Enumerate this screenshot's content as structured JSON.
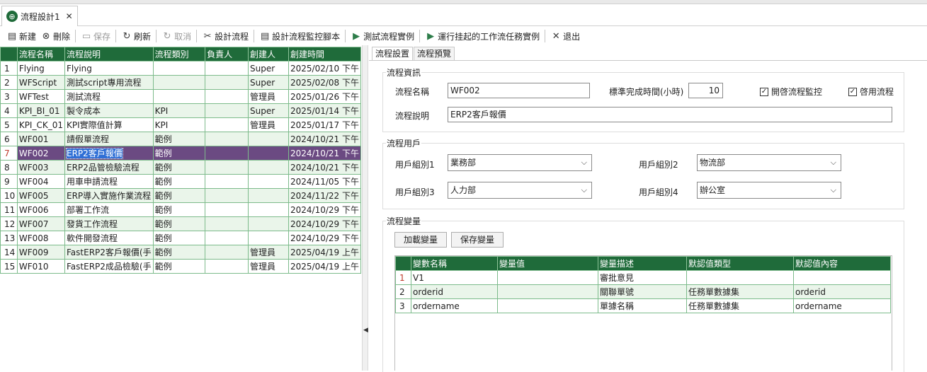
{
  "tab": {
    "title": "流程設計1",
    "close": "✕"
  },
  "toolbar": {
    "new": "新建",
    "delete": "刪除",
    "save": "保存",
    "refresh": "刷新",
    "cancel": "取消",
    "design": "設計流程",
    "monitor_script": "設計流程監控腳本",
    "test": "測試流程實例",
    "run_pending": "運行挂起的工作流任務實例",
    "exit": "退出"
  },
  "flow_grid": {
    "columns": [
      "流程名稱",
      "流程說明",
      "流程類別",
      "負責人",
      "創建人",
      "創建時間"
    ],
    "rows": [
      {
        "n": "1",
        "name": "Flying",
        "desc": "Flying",
        "cat": "",
        "owner": "",
        "creator": "Super",
        "time": "2025/02/10 下午"
      },
      {
        "n": "2",
        "name": "WFScript",
        "desc": "測試script專用流程",
        "cat": "",
        "owner": "",
        "creator": "Super",
        "time": "2025/02/08 下午"
      },
      {
        "n": "3",
        "name": "WFTest",
        "desc": "測試流程",
        "cat": "",
        "owner": "",
        "creator": "管理員",
        "time": "2025/01/26 下午"
      },
      {
        "n": "4",
        "name": "KPI_BI_01",
        "desc": "製令成本",
        "cat": "KPI",
        "owner": "",
        "creator": "Super",
        "time": "2025/01/14 下午"
      },
      {
        "n": "5",
        "name": "KPI_CK_01",
        "desc": "KPI實際值計算",
        "cat": "KPI",
        "owner": "",
        "creator": "管理員",
        "time": "2025/01/17 下午"
      },
      {
        "n": "6",
        "name": "WF001",
        "desc": "請假單流程",
        "cat": "範例",
        "owner": "",
        "creator": "",
        "time": "2024/10/21 下午"
      },
      {
        "n": "7",
        "name": "WF002",
        "desc": "ERP2客戶報價",
        "cat": "範例",
        "owner": "",
        "creator": "",
        "time": "2024/10/21 下午"
      },
      {
        "n": "8",
        "name": "WF003",
        "desc": "ERP2品管檢驗流程",
        "cat": "範例",
        "owner": "",
        "creator": "",
        "time": "2024/10/21 下午"
      },
      {
        "n": "9",
        "name": "WF004",
        "desc": "用車申請流程",
        "cat": "範例",
        "owner": "",
        "creator": "",
        "time": "2024/11/05 下午"
      },
      {
        "n": "10",
        "name": "WF005",
        "desc": "ERP導入實施作業流程",
        "cat": "範例",
        "owner": "",
        "creator": "",
        "time": "2024/11/22 下午"
      },
      {
        "n": "11",
        "name": "WF006",
        "desc": "部署工作流",
        "cat": "範例",
        "owner": "",
        "creator": "",
        "time": "2024/10/29 下午"
      },
      {
        "n": "12",
        "name": "WF007",
        "desc": "發貨工作流程",
        "cat": "範例",
        "owner": "",
        "creator": "",
        "time": "2024/10/29 下午"
      },
      {
        "n": "13",
        "name": "WF008",
        "desc": "軟件開發流程",
        "cat": "範例",
        "owner": "",
        "creator": "",
        "time": "2024/10/29 下午"
      },
      {
        "n": "14",
        "name": "WF009",
        "desc": "FastERP2客戶報價(手",
        "cat": "範例",
        "owner": "",
        "creator": "管理員",
        "time": "2025/04/19 上午"
      },
      {
        "n": "15",
        "name": "WF010",
        "desc": "FastERP2成品檢驗(手",
        "cat": "範例",
        "owner": "",
        "creator": "管理員",
        "time": "2025/04/19 上午"
      }
    ]
  },
  "right_tabs": [
    "流程設置",
    "流程預覽"
  ],
  "info": {
    "legend": "流程資訊",
    "name_label": "流程名稱",
    "name_value": "WF002",
    "std_time_label": "標準完成時間(小時)",
    "std_time_value": "10",
    "monitor_label": "開啓流程監控",
    "enable_label": "啓用流程",
    "desc_label": "流程說明",
    "desc_value": "ERP2客戶報價",
    "check": "✓"
  },
  "users": {
    "legend": "流程用戶",
    "g1_label": "用戶組別1",
    "g1_value": "業務部",
    "g2_label": "用戶組別2",
    "g2_value": "物流部",
    "g3_label": "用戶組別3",
    "g3_value": "人力部",
    "g4_label": "用戶組別4",
    "g4_value": "辦公室"
  },
  "vars": {
    "legend": "流程變量",
    "load": "加載變量",
    "save": "保存變量",
    "columns": [
      "變數名稱",
      "變量值",
      "變量描述",
      "默認值類型",
      "默認值內容"
    ],
    "rows": [
      {
        "n": "1",
        "name": "V1",
        "value": "",
        "desc": "審批意見",
        "type": "",
        "content": ""
      },
      {
        "n": "2",
        "name": "orderid",
        "value": "",
        "desc": "關聯單號",
        "type": "任務單數據集",
        "content": "orderid"
      },
      {
        "n": "3",
        "name": "ordername",
        "value": "",
        "desc": "單據名稱",
        "type": "任務單數據集",
        "content": "ordername"
      }
    ]
  }
}
